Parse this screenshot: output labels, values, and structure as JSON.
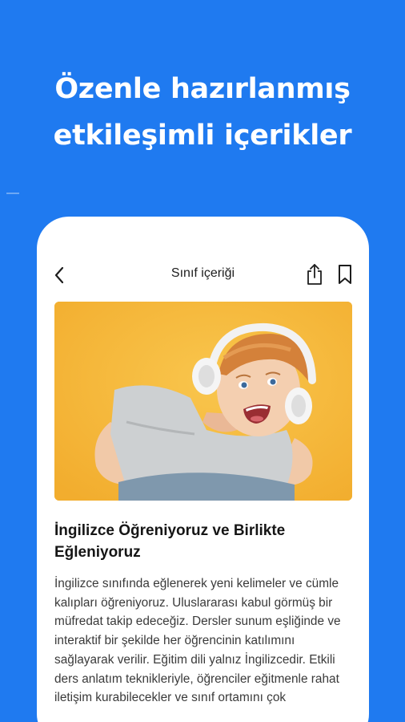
{
  "headline": {
    "line1": "Özenle hazırlanmış",
    "line2": "etkileşimli içerikler"
  },
  "nav": {
    "title": "Sınıf içeriği",
    "back_icon": "chevron-left-icon",
    "share_icon": "share-icon",
    "bookmark_icon": "bookmark-icon"
  },
  "hero_image": {
    "subject": "smiling child wearing white headphones on a yellow background"
  },
  "article": {
    "title": "İngilizce Öğreniyoruz ve Birlikte Eğleniyoruz",
    "body": "İngilizce sınıfında eğlenerek yeni kelimeler ve cümle kalıpları öğreniyoruz. Uluslararası kabul görmüş bir müfredat takip edeceğiz. Dersler sunum eşliğinde ve interaktif bir şekilde her öğrencinin katılımını sağlayarak verilir. Eğitim dili yalnız İngilizcedir. Etkili ders anlatım teknikleriyle, öğrenciler eğitmenle rahat iletişim kurabilecekler ve sınıf ortamını çok"
  },
  "colors": {
    "background": "#1f7af0",
    "card": "#ffffff",
    "hero_bg": "#f6b93a"
  }
}
